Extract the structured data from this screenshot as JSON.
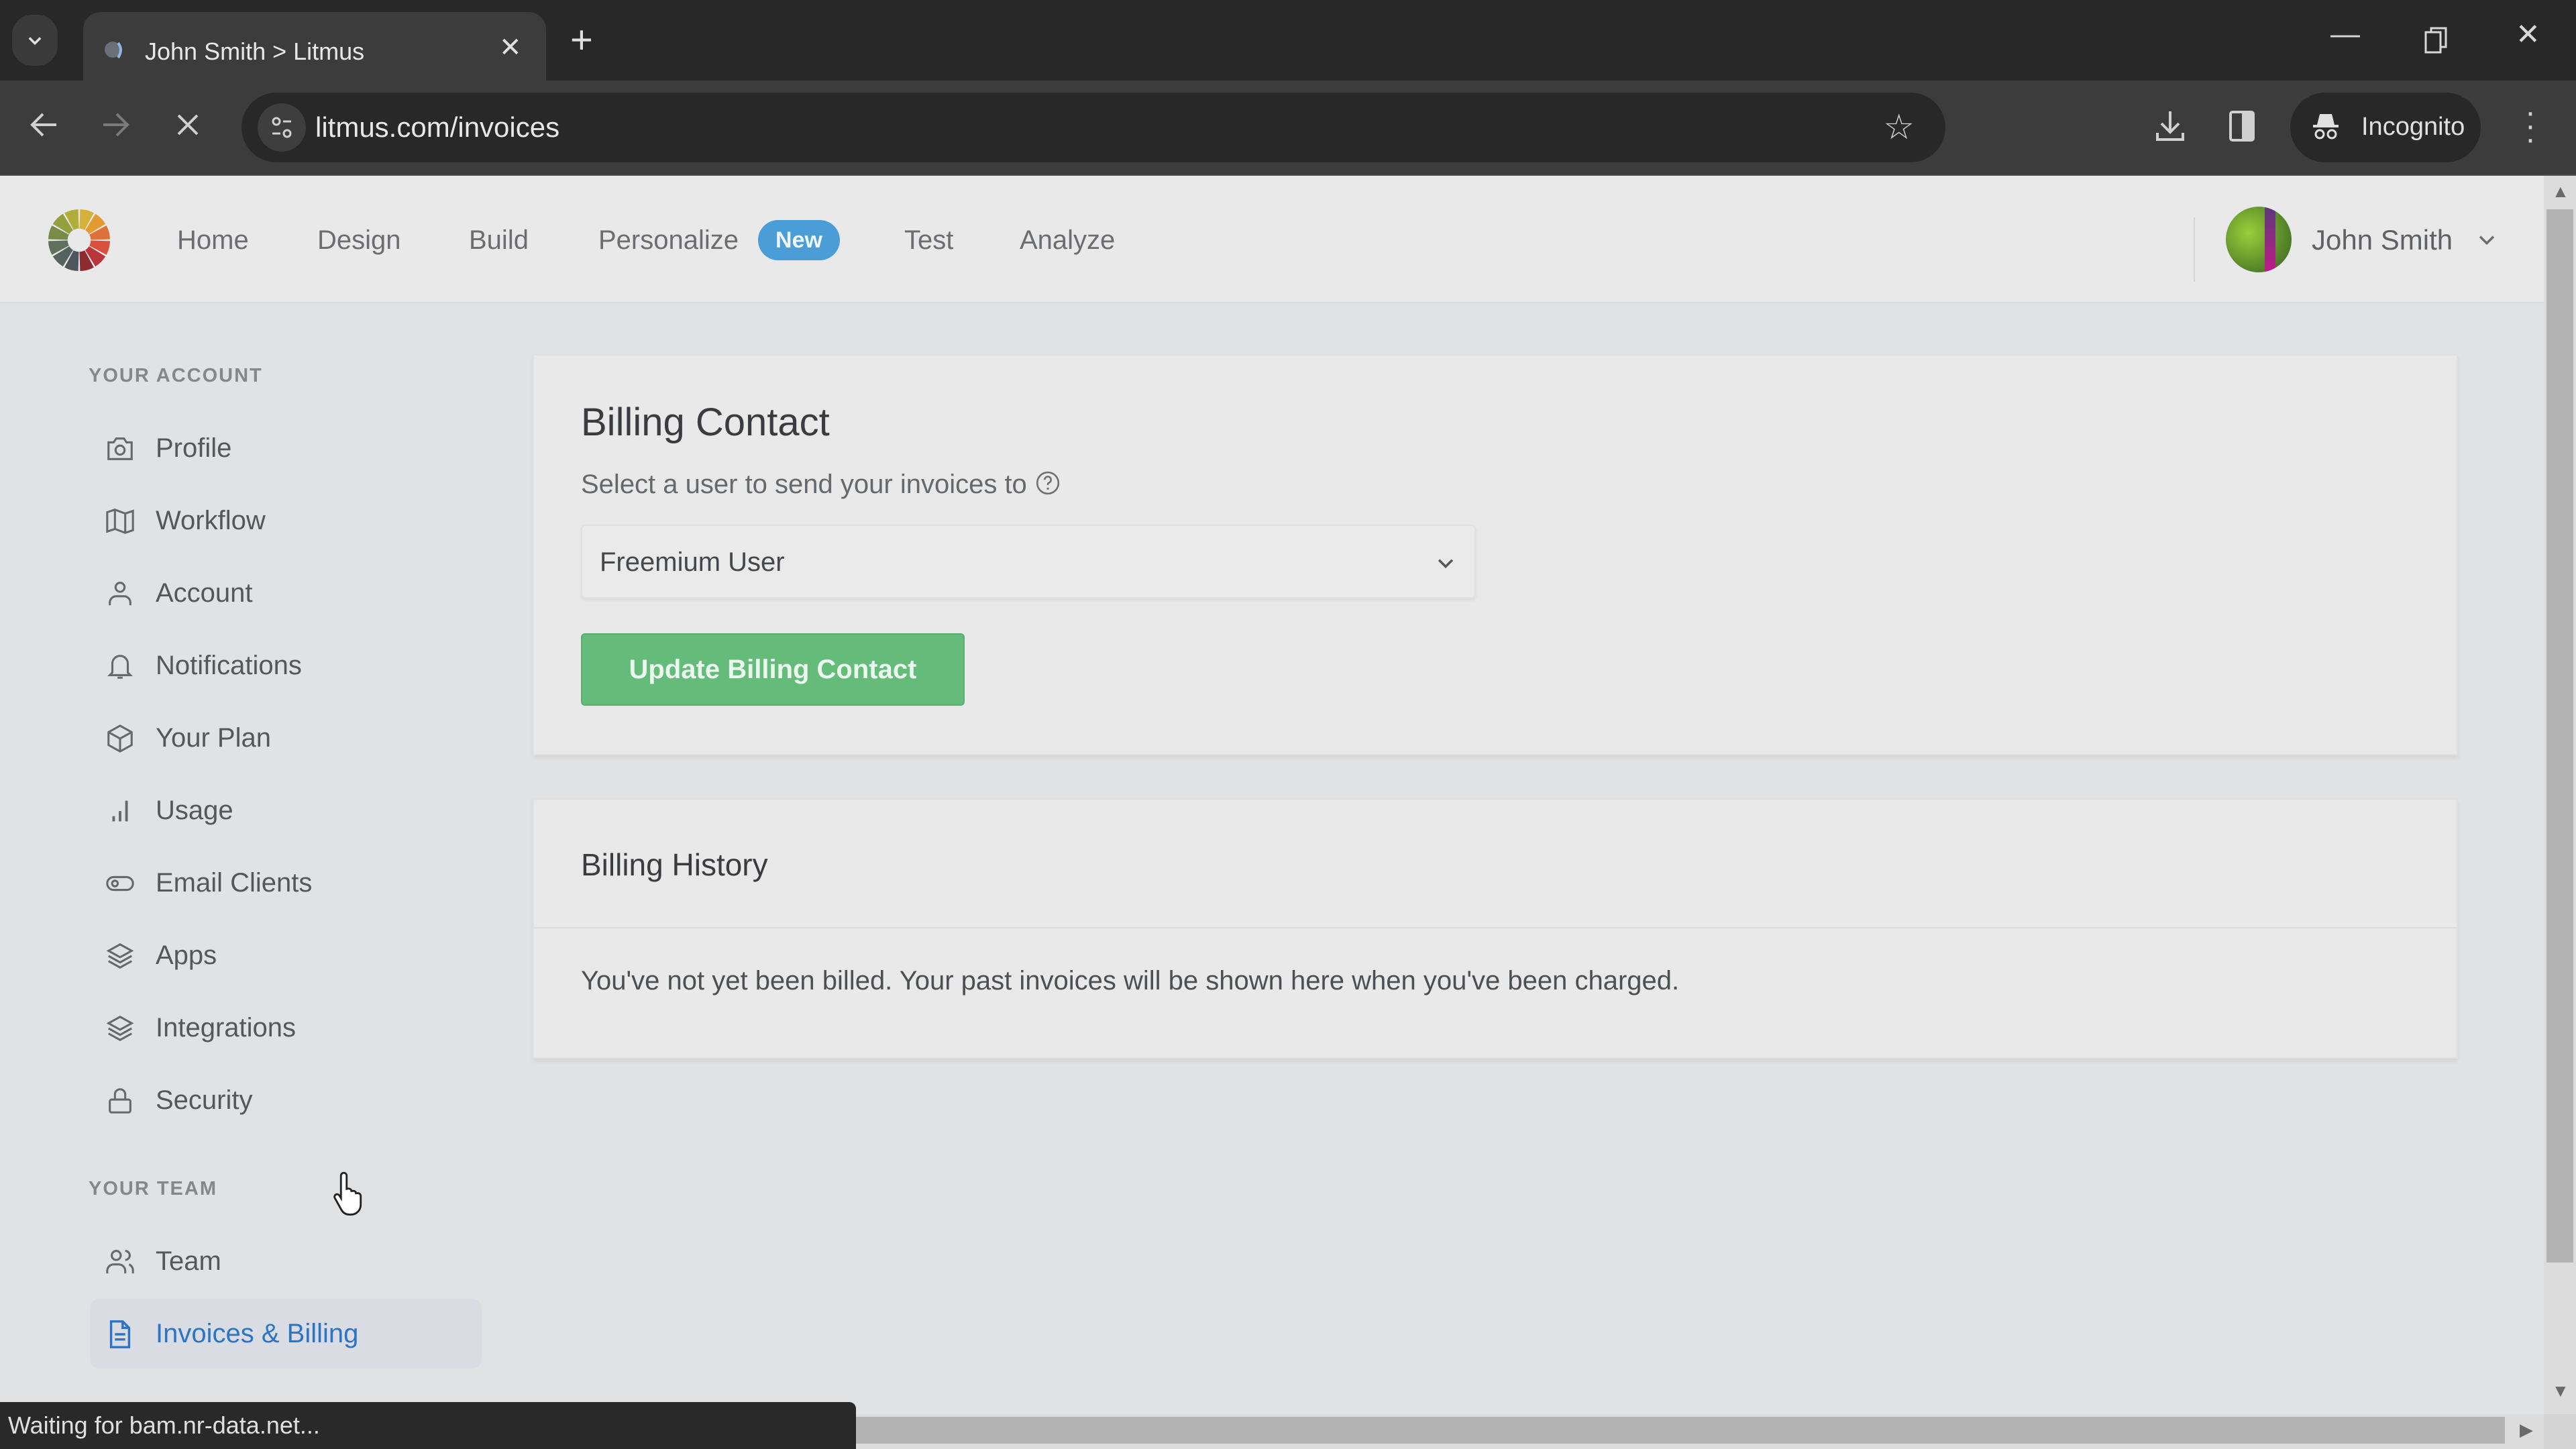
{
  "browser": {
    "tab_title": "John Smith > Litmus",
    "url": "litmus.com/invoices",
    "incognito_label": "Incognito",
    "icons": [
      "tab-search-icon",
      "favicon-icon",
      "close-tab-icon",
      "new-tab-icon",
      "minimize-icon",
      "restore-icon",
      "close-window-icon",
      "back-icon",
      "forward-icon",
      "stop-loading-icon",
      "site-info-icon",
      "bookmark-star-icon",
      "download-icon",
      "side-panel-icon",
      "incognito-icon",
      "menu-kebab-icon"
    ],
    "status_text": "Waiting for bam.nr-data.net..."
  },
  "header": {
    "nav": [
      {
        "label": "Home"
      },
      {
        "label": "Design"
      },
      {
        "label": "Build"
      },
      {
        "label": "Personalize",
        "badge": "New"
      },
      {
        "label": "Test"
      },
      {
        "label": "Analyze"
      }
    ],
    "user_name": "John Smith",
    "badge_color": "#4a9dd6"
  },
  "sidebar": {
    "sections": [
      {
        "title": "YOUR ACCOUNT",
        "items": [
          {
            "label": "Profile",
            "icon": "camera-icon"
          },
          {
            "label": "Workflow",
            "icon": "map-icon"
          },
          {
            "label": "Account",
            "icon": "user-icon"
          },
          {
            "label": "Notifications",
            "icon": "bell-icon"
          },
          {
            "label": "Your Plan",
            "icon": "box-icon"
          },
          {
            "label": "Usage",
            "icon": "bar-chart-icon"
          },
          {
            "label": "Email Clients",
            "icon": "toggle-icon"
          },
          {
            "label": "Apps",
            "icon": "layers-icon"
          },
          {
            "label": "Integrations",
            "icon": "layers-icon"
          },
          {
            "label": "Security",
            "icon": "lock-icon"
          }
        ]
      },
      {
        "title": "YOUR TEAM",
        "items": [
          {
            "label": "Team",
            "icon": "users-icon"
          },
          {
            "label": "Invoices & Billing",
            "icon": "document-icon",
            "active": true
          }
        ]
      }
    ],
    "active_color": "#2e74c4"
  },
  "billing_contact": {
    "title": "Billing Contact",
    "subtitle": "Select a user to send your invoices to",
    "selected_user": "Freemium User",
    "button_label": "Update Billing Contact",
    "button_color": "#65bb7a"
  },
  "billing_history": {
    "title": "Billing History",
    "empty_message": "You've not yet been billed. Your past invoices will be shown here when you've been charged."
  }
}
